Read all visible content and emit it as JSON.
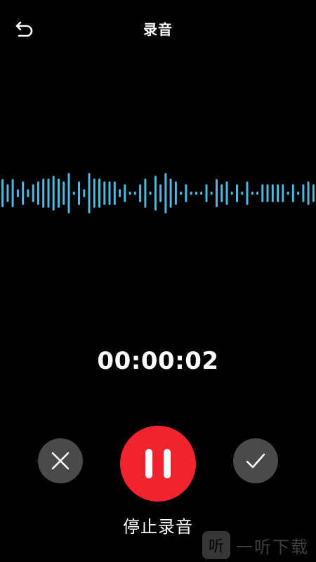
{
  "header": {
    "title": "录音",
    "back_icon": "back-arrow-icon"
  },
  "recording": {
    "elapsed": "00:00:02",
    "state_label": "停止录音",
    "waveform_color": "#4fb8e0",
    "waveform_levels": [
      0.5,
      0.32,
      0.5,
      0.14,
      0.42,
      0.14,
      0.32,
      0.42,
      0.52,
      0.52,
      0.62,
      0.52,
      0.42,
      0.72,
      0.06,
      0.42,
      0.14,
      0.72,
      0.52,
      0.52,
      0.42,
      0.42,
      0.42,
      0.14,
      0.32,
      0.06,
      0.06,
      0.32,
      0.52,
      0.06,
      0.62,
      0.32,
      0.72,
      0.52,
      0.42,
      0.06,
      0.32,
      0.06,
      0.06,
      0.06,
      0.32,
      0.06,
      0.5,
      0.32,
      0.42,
      0.06,
      0.32,
      0.06,
      0.42,
      0.06,
      0.06,
      0.32,
      0.32,
      0.32,
      0.32,
      0.32,
      0.06,
      0.32,
      0.06,
      0.32,
      0.42,
      0.32
    ],
    "accent_color": "#f0232f"
  },
  "controls": {
    "cancel_icon": "close-icon",
    "pause_icon": "pause-icon",
    "confirm_icon": "checkmark-icon"
  },
  "watermark": {
    "logo_char": "听",
    "text": "一听下载"
  }
}
